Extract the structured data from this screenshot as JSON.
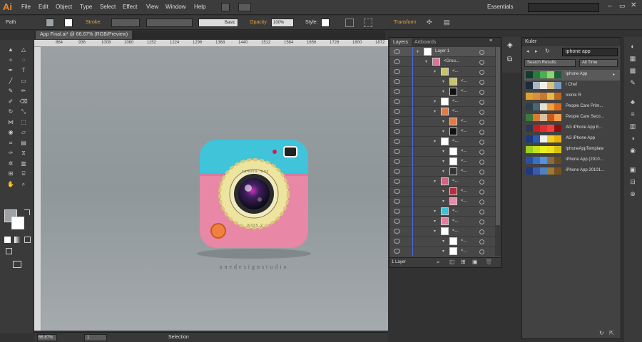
{
  "app": {
    "logo": "Ai",
    "workspace": "Essentials",
    "search_placeholder": ""
  },
  "menu": [
    "File",
    "Edit",
    "Object",
    "Type",
    "Select",
    "Effect",
    "View",
    "Window",
    "Help"
  ],
  "control": {
    "selection_label": "Path",
    "stroke_label": "Stroke:",
    "brush": "Basic",
    "opacity_label": "Opacity:",
    "opacity_value": "100%",
    "style_label": "Style:",
    "transform_label": "Transform"
  },
  "document": {
    "tab_title": "App Final.ai* @ 66.67% (RGB/Preview)"
  },
  "ruler": {
    "ticks": [
      "864",
      "936",
      "1008",
      "1080",
      "1152",
      "1224",
      "1296",
      "1368",
      "1440",
      "1512",
      "1584",
      "1656",
      "1728",
      "1800",
      "1872"
    ]
  },
  "artwork": {
    "brand_text": "onedesignstudio",
    "ring_text_top": "camera lens",
    "ring_text_bottom": "KIDS 2"
  },
  "status": {
    "zoom": "66.67%",
    "page": "1",
    "mode": "Selection"
  },
  "layers": {
    "tabs": [
      "Layers",
      "Artboards"
    ],
    "footer": "1 Layer",
    "rows": [
      {
        "indent": 0,
        "label": "Layer 1",
        "thumb": "#ffffff",
        "selected": true
      },
      {
        "indent": 1,
        "label": "<Grou...",
        "thumb": "#d8749a"
      },
      {
        "indent": 2,
        "label": "<...",
        "thumb": "#c9c36a"
      },
      {
        "indent": 3,
        "label": "<...",
        "thumb": "#c9c36a"
      },
      {
        "indent": 3,
        "label": "<...",
        "thumb": "#111111"
      },
      {
        "indent": 2,
        "label": "<...",
        "thumb": "#ffffff"
      },
      {
        "indent": 2,
        "label": "<...",
        "thumb": "#e07b4a"
      },
      {
        "indent": 3,
        "label": "<...",
        "thumb": "#e07b4a"
      },
      {
        "indent": 3,
        "label": "<...",
        "thumb": "#111111"
      },
      {
        "indent": 2,
        "label": "<...",
        "thumb": "#ffffff"
      },
      {
        "indent": 3,
        "label": "<...",
        "thumb": "#ffffff"
      },
      {
        "indent": 3,
        "label": "<...",
        "thumb": "#ffffff"
      },
      {
        "indent": 3,
        "label": "<...",
        "thumb": "#333333"
      },
      {
        "indent": 2,
        "label": "<...",
        "thumb": "#d86080"
      },
      {
        "indent": 3,
        "label": "<...",
        "thumb": "#b03040"
      },
      {
        "indent": 3,
        "label": "<...",
        "thumb": "#e88aa8"
      },
      {
        "indent": 2,
        "label": "<...",
        "thumb": "#3cc3d8"
      },
      {
        "indent": 2,
        "label": "<...",
        "thumb": "#e87ca0"
      },
      {
        "indent": 2,
        "label": "<...",
        "thumb": "#ffffff"
      },
      {
        "indent": 3,
        "label": "<...",
        "thumb": "#ffffff"
      },
      {
        "indent": 3,
        "label": "<...",
        "thumb": "#ffffff"
      }
    ]
  },
  "kuler": {
    "title": "Kuler",
    "search_value": "iphone app",
    "filter": "Search Results",
    "time": "All Time",
    "themes": [
      {
        "name": "Iphone App",
        "colors": [
          "#0f3d2e",
          "#2a7a3a",
          "#4cae52",
          "#93d36b",
          "#1b5e3a"
        ],
        "selected": true
      },
      {
        "name": "I Chef",
        "colors": [
          "#1e2b3a",
          "#a8b8c8",
          "#f0f0e8",
          "#d8c080",
          "#7a9ab8"
        ]
      },
      {
        "name": "Iconic R",
        "colors": [
          "#e0a030",
          "#d89040",
          "#c87a30",
          "#e8b850",
          "#b86a20"
        ]
      },
      {
        "name": "People Care Prim...",
        "colors": [
          "#2b3e4a",
          "#4a6478",
          "#e8e0d0",
          "#f0a040",
          "#d86a20"
        ]
      },
      {
        "name": "People Care Seco...",
        "colors": [
          "#3a7a3a",
          "#e07830",
          "#d8c0a0",
          "#c85a20",
          "#f0a050"
        ]
      },
      {
        "name": "AG iPhone App E...",
        "colors": [
          "#2a3a50",
          "#c02020",
          "#e03030",
          "#f04040",
          "#8a1010"
        ]
      },
      {
        "name": "AG iPhone App",
        "colors": [
          "#1a3a80",
          "#2a5ab0",
          "#f0f0f0",
          "#f0d020",
          "#e8b010"
        ]
      },
      {
        "name": "IphoneAppTemplate",
        "colors": [
          "#9ad020",
          "#c8e020",
          "#e8f020",
          "#f0e020",
          "#d8c010"
        ]
      },
      {
        "name": "iPhone App (2010...",
        "colors": [
          "#2a50a0",
          "#3a70c0",
          "#5a90d8",
          "#8a6a40",
          "#6a4a20"
        ]
      },
      {
        "name": "iPhone App 20101...",
        "colors": [
          "#203a80",
          "#3a5ab0",
          "#5080c0",
          "#a07830",
          "#7a5020"
        ]
      }
    ]
  }
}
